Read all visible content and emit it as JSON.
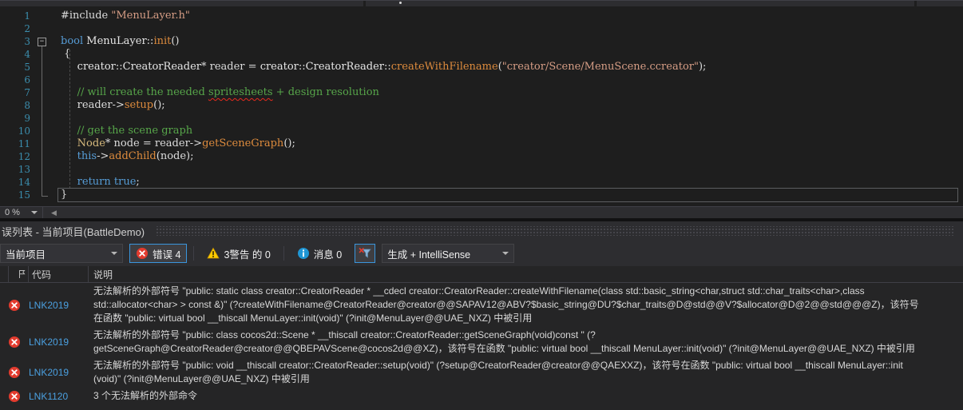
{
  "editor": {
    "zoom_level": "0 %",
    "current_line": 15,
    "fold": {
      "start": 3,
      "end": 15
    },
    "indent_guide": {
      "start": 4,
      "end": 14
    },
    "lines": [
      {
        "n": 1,
        "segs": [
          {
            "c": "d",
            "t": "#include "
          },
          {
            "c": "s",
            "t": "\"MenuLayer.h\""
          }
        ]
      },
      {
        "n": 2,
        "segs": []
      },
      {
        "n": 3,
        "fold": "minus",
        "segs": [
          {
            "c": "k",
            "t": "bool"
          },
          {
            "c": "d",
            "t": " "
          },
          {
            "c": "t",
            "t": "MenuLayer"
          },
          {
            "c": "d",
            "t": "::"
          },
          {
            "c": "f",
            "t": "init"
          },
          {
            "c": "d",
            "t": "()"
          }
        ]
      },
      {
        "n": 4,
        "segs": [
          {
            "c": "d",
            "t": " {"
          }
        ]
      },
      {
        "n": 5,
        "segs": [
          {
            "c": "d",
            "t": "     "
          },
          {
            "c": "t",
            "t": "creator"
          },
          {
            "c": "d",
            "t": "::"
          },
          {
            "c": "t",
            "t": "CreatorReader"
          },
          {
            "c": "d",
            "t": "* reader = "
          },
          {
            "c": "t",
            "t": "creator"
          },
          {
            "c": "d",
            "t": "::"
          },
          {
            "c": "t",
            "t": "CreatorReader"
          },
          {
            "c": "d",
            "t": "::"
          },
          {
            "c": "f",
            "t": "createWithFilename"
          },
          {
            "c": "d",
            "t": "("
          },
          {
            "c": "s",
            "t": "\"creator/Scene/MenuScene.ccreator\""
          },
          {
            "c": "d",
            "t": ");"
          }
        ]
      },
      {
        "n": 6,
        "segs": []
      },
      {
        "n": 7,
        "segs": [
          {
            "c": "c",
            "t": "     // will create the needed "
          },
          {
            "c": "c sq",
            "t": "spritesheets"
          },
          {
            "c": "c",
            "t": " + design resolution"
          }
        ]
      },
      {
        "n": 8,
        "segs": [
          {
            "c": "d",
            "t": "     reader->"
          },
          {
            "c": "f",
            "t": "setup"
          },
          {
            "c": "d",
            "t": "();"
          }
        ]
      },
      {
        "n": 9,
        "segs": []
      },
      {
        "n": 10,
        "segs": [
          {
            "c": "c",
            "t": "     // get the scene graph"
          }
        ]
      },
      {
        "n": 11,
        "segs": [
          {
            "c": "d",
            "t": "     "
          },
          {
            "c": "y",
            "t": "Node"
          },
          {
            "c": "d",
            "t": "* node = reader->"
          },
          {
            "c": "f",
            "t": "getSceneGraph"
          },
          {
            "c": "d",
            "t": "();"
          }
        ]
      },
      {
        "n": 12,
        "segs": [
          {
            "c": "d",
            "t": "     "
          },
          {
            "c": "k",
            "t": "this"
          },
          {
            "c": "d",
            "t": "->"
          },
          {
            "c": "f",
            "t": "addChild"
          },
          {
            "c": "d",
            "t": "(node);"
          }
        ]
      },
      {
        "n": 13,
        "segs": []
      },
      {
        "n": 14,
        "segs": [
          {
            "c": "d",
            "t": "     "
          },
          {
            "c": "k",
            "t": "return"
          },
          {
            "c": "d",
            "t": " "
          },
          {
            "c": "k",
            "t": "true"
          },
          {
            "c": "d",
            "t": ";"
          }
        ]
      },
      {
        "n": 15,
        "segs": [
          {
            "c": "d",
            "t": "}"
          }
        ]
      }
    ]
  },
  "error_list": {
    "title": "误列表 - 当前项目(BattleDemo)",
    "toolbar": {
      "scope_dropdown": "当前项目",
      "errors_button": "错误 4",
      "warnings_button": "3警告 的 0",
      "messages_button": "消息 0",
      "build_dropdown": "生成 + IntelliSense"
    },
    "columns": {
      "code": "代码",
      "description": "说明"
    },
    "rows": [
      {
        "severity": "error",
        "code": "LNK2019",
        "description_lines": [
          "无法解析的外部符号 \"public: static class creator::CreatorReader * __cdecl creator::CreatorReader::createWithFilename(class std::basic_string<char,struct std::char_traits<char>,class",
          "std::allocator<char> > const &)\" (?createWithFilename@CreatorReader@creator@@SAPAV12@ABV?$basic_string@DU?$char_traits@D@std@@V?$allocator@D@2@@std@@@Z)，该符号",
          "在函数 \"public: virtual bool __thiscall MenuLayer::init(void)\" (?init@MenuLayer@@UAE_NXZ) 中被引用"
        ]
      },
      {
        "severity": "error",
        "code": "LNK2019",
        "description_lines": [
          "无法解析的外部符号 \"public: class cocos2d::Scene * __thiscall creator::CreatorReader::getSceneGraph(void)const \" (?",
          "getSceneGraph@CreatorReader@creator@@QBEPAVScene@cocos2d@@XZ)，该符号在函数 \"public: virtual bool __thiscall MenuLayer::init(void)\" (?init@MenuLayer@@UAE_NXZ) 中被引用"
        ]
      },
      {
        "severity": "error",
        "code": "LNK2019",
        "description_lines": [
          "无法解析的外部符号 \"public: void __thiscall creator::CreatorReader::setup(void)\" (?setup@CreatorReader@creator@@QAEXXZ)，该符号在函数 \"public: virtual bool __thiscall MenuLayer::init",
          "(void)\" (?init@MenuLayer@@UAE_NXZ) 中被引用"
        ]
      },
      {
        "severity": "error",
        "code": "LNK1120",
        "description_lines": [
          "3 个无法解析的外部命令"
        ]
      }
    ]
  },
  "colors": {
    "accent_border": "#3a96dd",
    "error_red": "#e23b2e",
    "warning_yellow": "#ffcc00",
    "info_blue": "#1f96d4",
    "code_link_blue": "#4ba0e0",
    "editor_background": "#1e1e1e",
    "panel_background": "#2d2d30"
  }
}
